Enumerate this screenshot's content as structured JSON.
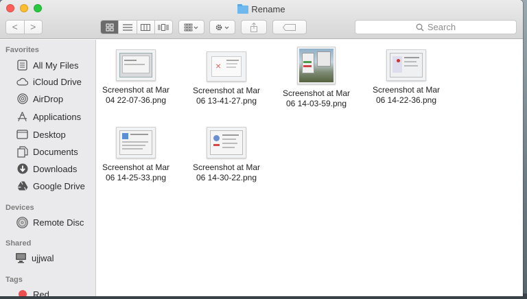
{
  "window": {
    "title": "Rename"
  },
  "toolbar": {
    "back_label": "<",
    "forward_label": ">",
    "search_placeholder": "Search"
  },
  "sidebar": {
    "favorites_label": "Favorites",
    "favorites": [
      {
        "label": "All My Files",
        "icon": "all-files-icon"
      },
      {
        "label": "iCloud Drive",
        "icon": "cloud-icon"
      },
      {
        "label": "AirDrop",
        "icon": "airdrop-icon"
      },
      {
        "label": "Applications",
        "icon": "applications-icon"
      },
      {
        "label": "Desktop",
        "icon": "desktop-icon"
      },
      {
        "label": "Documents",
        "icon": "documents-icon"
      },
      {
        "label": "Downloads",
        "icon": "downloads-icon"
      },
      {
        "label": "Google Drive",
        "icon": "google-drive-icon"
      }
    ],
    "devices_label": "Devices",
    "devices": [
      {
        "label": "Remote Disc",
        "icon": "disc-icon"
      }
    ],
    "shared_label": "Shared",
    "shared": [
      {
        "label": "ujjwal",
        "icon": "computer-icon"
      }
    ],
    "tags_label": "Tags",
    "tags": [
      {
        "label": "Red",
        "color": "#ee4d4d"
      }
    ]
  },
  "files": [
    {
      "line1": "Screenshot at Mar",
      "line2": "04 22-07-36.png"
    },
    {
      "line1": "Screenshot at Mar",
      "line2": "06 13-41-27.png"
    },
    {
      "line1": "Screenshot at Mar",
      "line2": "06 14-03-59.png"
    },
    {
      "line1": "Screenshot at Mar",
      "line2": "06 14-22-36.png"
    },
    {
      "line1": "Screenshot at Mar",
      "line2": "06 14-25-33.png"
    },
    {
      "line1": "Screenshot at Mar",
      "line2": "06 14-30-22.png"
    }
  ]
}
